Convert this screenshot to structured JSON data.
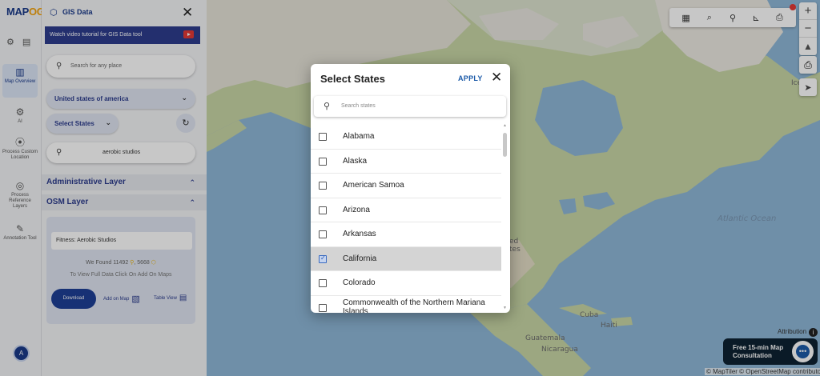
{
  "logo": {
    "part1": "MAP",
    "part2": "OG"
  },
  "panel": {
    "title": "GIS Data",
    "tutorial": "Watch video tutorial for GIS Data tool",
    "search_placeholder": "Search for any place",
    "country": "United states of america",
    "states_label": "Select States",
    "query_value": "aerobic studios",
    "admin_layer": "Administrative Layer",
    "osm_layer": "OSM Layer",
    "result_title": "Fitness: Aerobic Studios",
    "found_prefix": "We Found",
    "found_count_1": "11492",
    "found_count_2": "5668",
    "hint": "To View Full Data Click On Add On Maps",
    "download": "Download",
    "add_on_map": "Add on Map",
    "table_view": "Table View"
  },
  "rail": {
    "items": [
      {
        "label": "Map Overview",
        "icon": "map-icon"
      },
      {
        "label": "AI",
        "icon": "ai-icon"
      },
      {
        "label": "Process Custom Location",
        "icon": "location-pin-icon"
      },
      {
        "label": "Process Reference Layers",
        "icon": "layers-icon"
      },
      {
        "label": "Annotation Tool",
        "icon": "annotation-icon"
      }
    ],
    "avatar": "A"
  },
  "modal": {
    "title": "Select States",
    "apply": "APPLY",
    "search_placeholder": "Search states",
    "states": [
      {
        "name": "Alabama",
        "checked": false
      },
      {
        "name": "Alaska",
        "checked": false
      },
      {
        "name": "American Samoa",
        "checked": false
      },
      {
        "name": "Arizona",
        "checked": false
      },
      {
        "name": "Arkansas",
        "checked": false
      },
      {
        "name": "California",
        "checked": true
      },
      {
        "name": "Colorado",
        "checked": false
      },
      {
        "name": "Commonwealth of the Northern Mariana Islands",
        "checked": false
      }
    ]
  },
  "map": {
    "labels": {
      "atlantic": "Atlantic Ocean",
      "cuba": "Cuba",
      "haiti": "Haiti",
      "guatemala": "Guatemala",
      "nicaragua": "Nicaragua",
      "ice": "Ice",
      "ed": "ed",
      "tes": "tes"
    },
    "attribution": "Attribution",
    "copyright": "© MapTiler © OpenStreetMap contributors",
    "consult": "Free 15-min Map Consultation"
  }
}
